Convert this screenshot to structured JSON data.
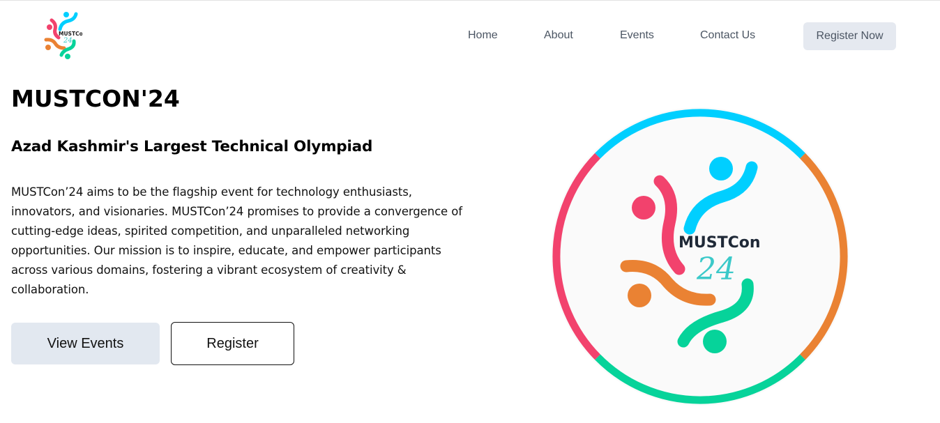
{
  "header": {
    "logo": {
      "text": "MUSTCon",
      "number": "24"
    },
    "nav": [
      {
        "label": "Home"
      },
      {
        "label": "About"
      },
      {
        "label": "Events"
      },
      {
        "label": "Contact Us"
      }
    ],
    "cta_label": "Register Now"
  },
  "hero": {
    "title": "MUSTCON'24",
    "subtitle": "Azad Kashmir's Largest Technical Olympiad",
    "description": "MUSTCon’24 aims to be the flagship event for technology enthusiasts, innovators, and visionaries. MUSTCon’24 promises to provide a convergence of cutting-edge ideas, spirited competition, and unparalleled networking opportunities. Our mission is to inspire, educate, and empower participants across various domains, fostering a vibrant ecosystem of creativity & collaboration.",
    "buttons": {
      "view_events": "View Events",
      "register": "Register"
    }
  },
  "emblem": {
    "text": "MUSTCon",
    "number": "24"
  },
  "colors": {
    "blue": "#00cfff",
    "pink": "#f2426d",
    "orange": "#ea8233",
    "green": "#06d39a",
    "teal_text": "#3bc9c9",
    "nav_text": "#4b5563",
    "button_bg": "#e2e8f0"
  }
}
